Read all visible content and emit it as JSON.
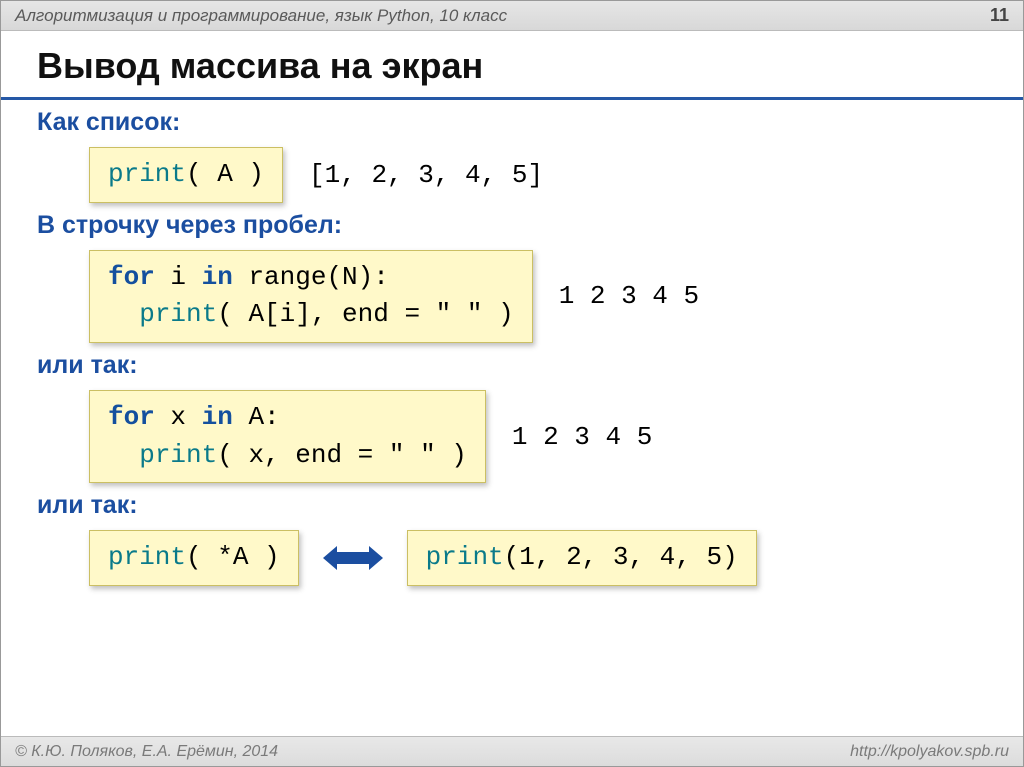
{
  "header": {
    "course": "Алгоритмизация и программирование, язык Python, 10 класс",
    "page": "11"
  },
  "title": "Вывод массива на экран",
  "sections": {
    "as_list": {
      "label": "Как список:",
      "code": {
        "fn": "print",
        "args": "( A )"
      },
      "output": "[1, 2, 3, 4, 5]"
    },
    "inline": {
      "label": "В строчку через пробел:",
      "code": {
        "line1_kw1": "for",
        "line1_mid": " i ",
        "line1_kw2": "in",
        "line1_rest": " range(N):",
        "line2_indent": "  ",
        "line2_fn": "print",
        "line2_args": "( A[i], end = \" \" )"
      },
      "output": "1 2 3 4 5"
    },
    "alt1": {
      "label": "или так:",
      "code": {
        "line1_kw1": "for",
        "line1_mid": " x ",
        "line1_kw2": "in",
        "line1_rest": " A:",
        "line2_indent": "  ",
        "line2_fn": "print",
        "line2_args": "( x, end = \" \" )"
      },
      "output": "1 2 3 4 5"
    },
    "alt2": {
      "label": "или так:",
      "left": {
        "fn": "print",
        "args": "( *A )"
      },
      "right": {
        "fn": "print",
        "args": "(1, 2, 3, 4, 5)"
      }
    }
  },
  "footer": {
    "copyright": "© К.Ю. Поляков, Е.А. Ерёмин, 2014",
    "url": "http://kpolyakov.spb.ru"
  },
  "colors": {
    "accent": "#2558a6",
    "codebg": "#fff9c9"
  }
}
